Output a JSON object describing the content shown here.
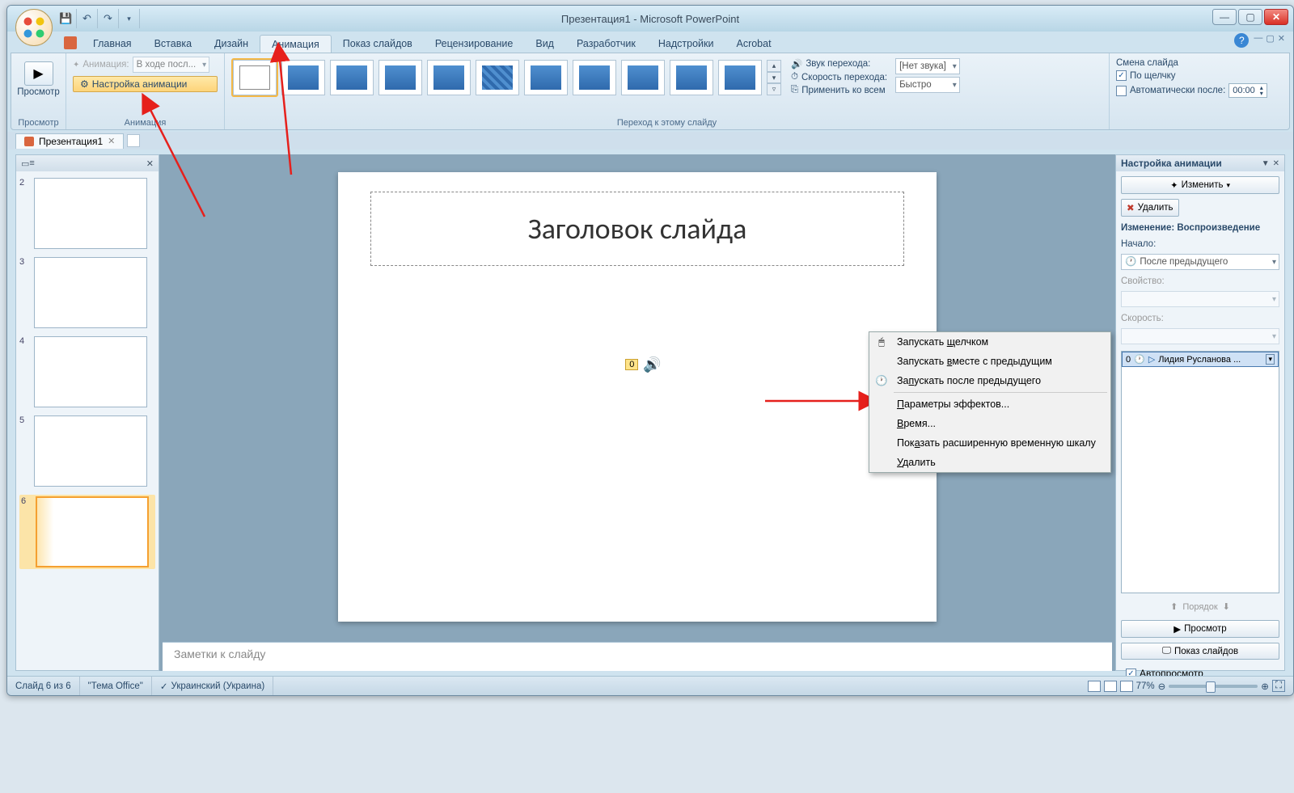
{
  "titlebar": {
    "title": "Презентация1 - Microsoft PowerPoint"
  },
  "tabs": {
    "items": [
      "Главная",
      "Вставка",
      "Дизайн",
      "Анимация",
      "Показ слайдов",
      "Рецензирование",
      "Вид",
      "Разработчик",
      "Надстройки",
      "Acrobat"
    ],
    "active": "Анимация"
  },
  "ribbon": {
    "preview": {
      "label": "Просмотр",
      "group": "Просмотр"
    },
    "anim": {
      "label": "Анимация:",
      "dropdown_value": "В ходе посл...",
      "custom_btn": "Настройка анимации",
      "group": "Анимация"
    },
    "transition": {
      "sound_label": "Звук перехода:",
      "sound_value": "[Нет звука]",
      "speed_label": "Скорость перехода:",
      "speed_value": "Быстро",
      "apply_all": "Применить ко всем",
      "group": "Переход к этому слайду"
    },
    "advance": {
      "header": "Смена слайда",
      "on_click": "По щелчку",
      "auto_after": "Автоматически после:",
      "time": "00:00"
    }
  },
  "doc_tab": "Презентация1",
  "thumbnails": {
    "slides": [
      "2",
      "3",
      "4",
      "5",
      "6"
    ],
    "selected": "6"
  },
  "slide": {
    "title_placeholder": "Заголовок слайда",
    "sound_tag": "0"
  },
  "notes": {
    "placeholder": "Заметки к слайду"
  },
  "anim_pane": {
    "title": "Настройка анимации",
    "change_btn": "Изменить",
    "remove_btn": "Удалить",
    "modify_header": "Изменение: Воспроизведение",
    "start_label": "Начало:",
    "start_value": "После предыдущего",
    "property_label": "Свойство:",
    "speed_label": "Скорость:",
    "entry": {
      "index": "0",
      "name": "Лидия Русланова ..."
    },
    "order_label": "Порядок",
    "preview_btn": "Просмотр",
    "slideshow_btn": "Показ слайдов",
    "autopreview": "Автопросмотр"
  },
  "context_menu": {
    "items": [
      "Запускать щелчком",
      "Запускать вместе с предыдущим",
      "Запускать после предыдущего",
      "Параметры эффектов...",
      "Время...",
      "Показать расширенную временную шкалу",
      "Удалить"
    ],
    "accel": [
      "щ",
      "в",
      "п",
      "П",
      "В",
      "а",
      "У"
    ]
  },
  "statusbar": {
    "slide": "Слайд 6 из 6",
    "theme": "\"Тема Office\"",
    "lang": "Украинский (Украина)",
    "zoom": "77%"
  }
}
